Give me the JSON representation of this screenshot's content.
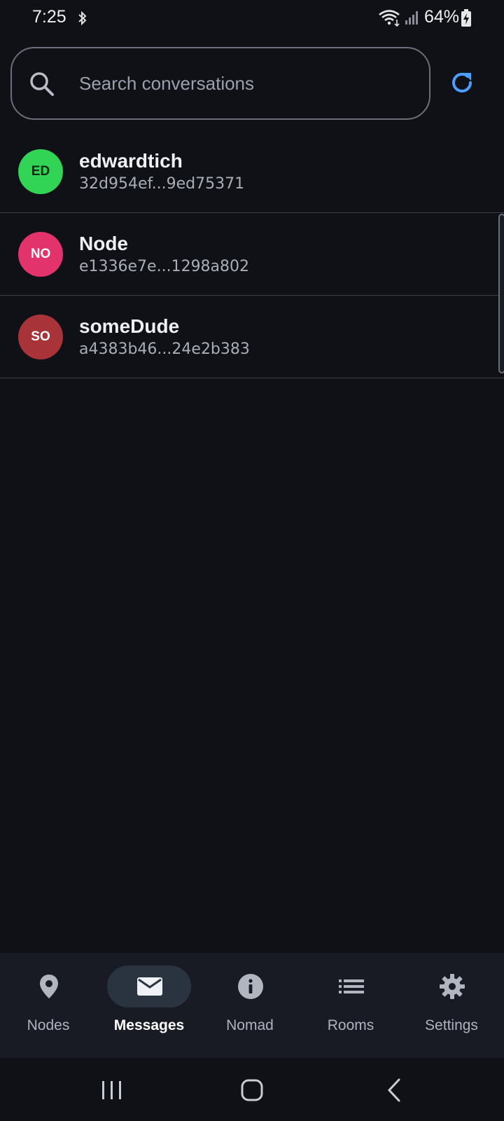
{
  "status": {
    "time": "7:25",
    "battery": "64%"
  },
  "search": {
    "placeholder": "Search conversations"
  },
  "conversations": [
    {
      "initials": "ED",
      "name": "edwardtich",
      "hash": "32d954ef...9ed75371",
      "avatar_color": "#31d454",
      "initials_color": "#0d2a12"
    },
    {
      "initials": "NO",
      "name": "Node",
      "hash": "e1336e7e...1298a802",
      "avatar_color": "#e2336c",
      "initials_color": "#ffffff"
    },
    {
      "initials": "SO",
      "name": "someDude",
      "hash": "a4383b46...24e2b383",
      "avatar_color": "#a8343a",
      "initials_color": "#ffffff"
    }
  ],
  "nav": {
    "items": [
      {
        "label": "Nodes",
        "icon": "location-pin-icon"
      },
      {
        "label": "Messages",
        "icon": "envelope-icon",
        "active": true
      },
      {
        "label": "Nomad",
        "icon": "info-icon"
      },
      {
        "label": "Rooms",
        "icon": "list-icon"
      },
      {
        "label": "Settings",
        "icon": "gear-icon"
      }
    ]
  },
  "colors": {
    "background": "#101116",
    "accent": "#4a9fff",
    "nav_background": "#181b23"
  }
}
